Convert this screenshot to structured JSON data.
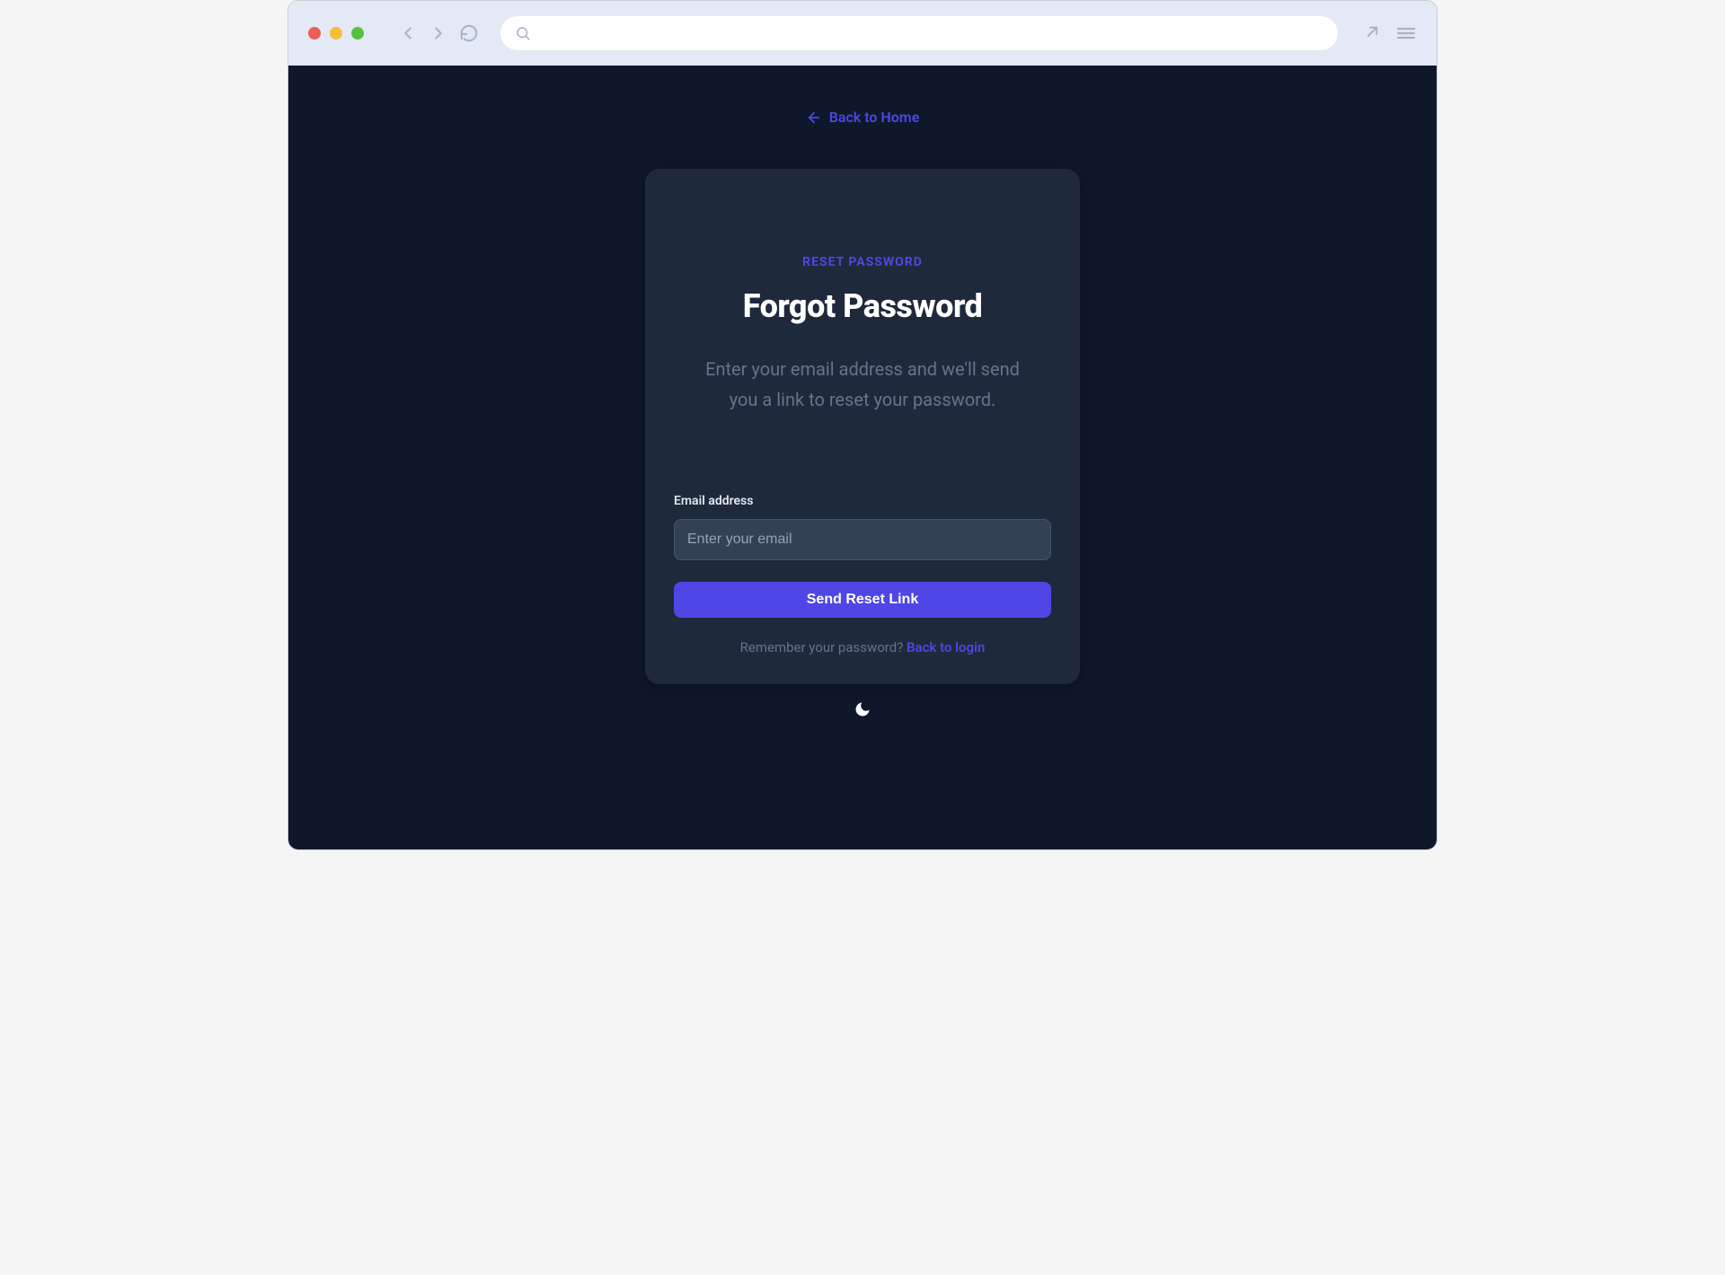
{
  "back_link": {
    "label": "Back to Home"
  },
  "card": {
    "badge": "RESET PASSWORD",
    "title": "Forgot Password",
    "subtitle": "Enter your email address and we'll send you a link to reset your password."
  },
  "form": {
    "email_label": "Email address",
    "email_placeholder": "Enter your email",
    "email_value": "",
    "submit_label": "Send Reset Link"
  },
  "footer": {
    "prompt": "Remember your password? ",
    "link_label": "Back to login"
  },
  "colors": {
    "accent": "#4f46e5",
    "page_bg": "#0f172a",
    "card_bg": "#1e293b",
    "input_bg": "#334155"
  }
}
